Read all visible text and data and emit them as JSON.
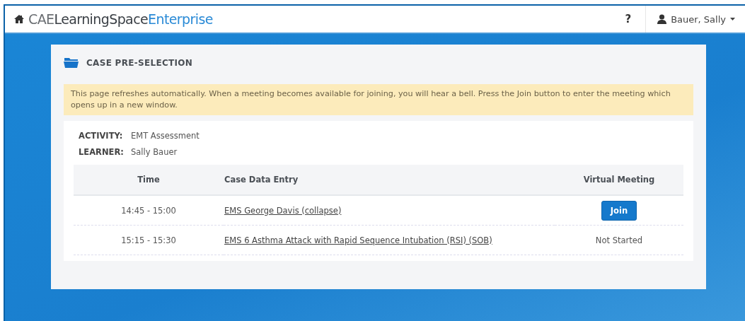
{
  "header": {
    "brand": {
      "prefix": "CAE",
      "name": "LearningSpace",
      "suffix": "Enterprise"
    },
    "help": "?",
    "user": "Bauer, Sally"
  },
  "panel": {
    "title": "CASE PRE-SELECTION",
    "notice": "This page refreshes automatically. When a meeting becomes available for joining, you will hear a bell. Press the Join button to enter the meeting which opens up in a new window.",
    "details": [
      {
        "label": "ACTIVITY:",
        "value": "EMT Assessment"
      },
      {
        "label": "LEARNER:",
        "value": "Sally Bauer"
      }
    ],
    "table": {
      "columns": [
        "Time",
        "Case Data Entry",
        "Virtual Meeting"
      ],
      "rows": [
        {
          "time": "14:45 - 15:00",
          "case": "EMS George Davis (collapse)",
          "meeting": {
            "kind": "button",
            "text": "Join"
          }
        },
        {
          "time": "15:15 - 15:30",
          "case": "EMS 6 Asthma Attack with Rapid Sequence Intubation (RSI) (SOB)",
          "meeting": {
            "kind": "status",
            "text": "Not Started"
          }
        }
      ]
    }
  }
}
